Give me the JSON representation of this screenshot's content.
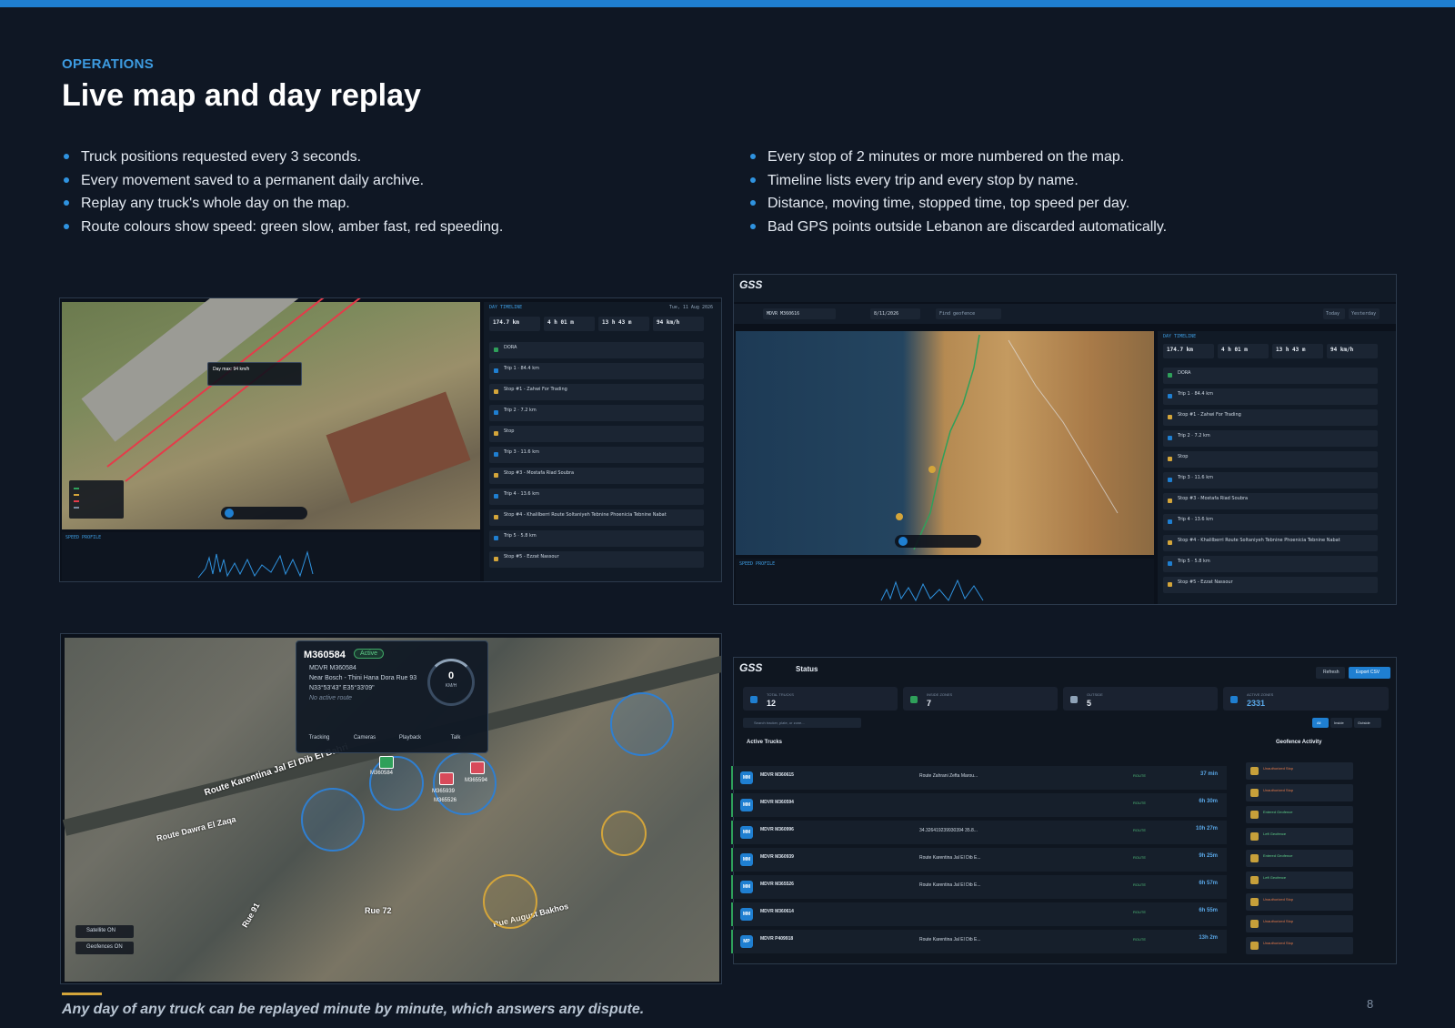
{
  "header": {
    "section_label": "OPERATIONS",
    "title": "Live map and day replay"
  },
  "bullets_left": [
    "Truck positions requested every 3 seconds.",
    "Every movement saved to a permanent daily archive.",
    "Replay any truck's whole day on the map.",
    "Route colours show speed: green slow, amber fast, red speeding."
  ],
  "bullets_right": [
    "Every stop of 2 minutes or more numbered on the map.",
    "Timeline lists every trip and every stop by name.",
    "Distance, moving time, stopped time, top speed per day.",
    "Bad GPS points outside Lebanon are discarded automatically."
  ],
  "shot1": {
    "panel_title": "DAY TIMELINE",
    "date": "Tue, 11 Aug 2026",
    "stats": [
      "174.7 km",
      "4 h 01 m",
      "13 h 43 m",
      "94 km/h"
    ],
    "tooltip_title": "Day max: 94 km/h",
    "speed_profile_label": "SPEED PROFILE",
    "timeline": [
      {
        "text": "DORA",
        "color": "#2fa05a"
      },
      {
        "text": "Trip 1 · 84.4 km",
        "color": "#1f7fd1"
      },
      {
        "text": "Stop #1 - Zahwi For Trading",
        "color": "#d4a53a"
      },
      {
        "text": "Trip 2 · 7.2 km",
        "color": "#1f7fd1"
      },
      {
        "text": "Stop",
        "color": "#d4a53a"
      },
      {
        "text": "Trip 3 · 11.6 km",
        "color": "#1f7fd1"
      },
      {
        "text": "Stop #3 - Mostafa Riad Soubra",
        "color": "#d4a53a"
      },
      {
        "text": "Trip 4 · 13.6 km",
        "color": "#1f7fd1"
      },
      {
        "text": "Stop #4 - Khalilberri Route Soltaniyeh Tebnine Phoenicia Tebnine Nabat",
        "color": "#d4a53a"
      },
      {
        "text": "Trip 5 · 5.8 km",
        "color": "#1f7fd1"
      },
      {
        "text": "Stop #5 - Ezzat Nassour",
        "color": "#d4a53a"
      }
    ]
  },
  "shot2": {
    "logo": "GSS",
    "tracker_value": "MDVR M360616",
    "date_value": "8/11/2026",
    "search_placeholder": "Find geofence",
    "today_label": "Today",
    "yesterday_label": "Yesterday",
    "panel_title": "DAY TIMELINE",
    "stats": [
      "174.7 km",
      "4 h 01 m",
      "13 h 43 m",
      "94 km/h"
    ],
    "speed_profile_label": "SPEED PROFILE"
  },
  "shot3": {
    "popup_title": "M360584",
    "popup_badge": "Active",
    "popup_lines": [
      "MDVR M360584",
      "Near Bosch - Thini Hana Dora Rue 93",
      "N33°53'43\" E35°33'09\"",
      "No active route"
    ],
    "speed_value": "0",
    "speed_unit": "KM/H",
    "actions": [
      "Tracking",
      "Cameras",
      "Playback",
      "Talk"
    ],
    "map_labels": [
      "M360584",
      "M365939",
      "M365526",
      "M365594",
      "Route Karentina Jal El Dib El Bahri",
      "Route Dawra El Zaqa",
      "Rue August Bakhos",
      "Rue 72",
      "Rue 91"
    ],
    "layer_toggles": [
      "Satellite ON",
      "Geofences ON"
    ]
  },
  "shot4": {
    "logo": "GSS",
    "title": "Status",
    "refresh_label": "Refresh",
    "export_label": "Export CSV",
    "cards": [
      {
        "label": "TOTAL TRUCKS",
        "value": "12",
        "color": "#1f7fd1"
      },
      {
        "label": "INSIDE ZONES",
        "value": "7",
        "color": "#2fa05a"
      },
      {
        "label": "OUTSIDE",
        "value": "5",
        "color": "#8fa3b8"
      },
      {
        "label": "ACTIVE ZONES",
        "value": "2331",
        "color": "#1f7fd1"
      }
    ],
    "search_placeholder": "Search tracker, plate, or zone...",
    "filters": [
      "All",
      "Inside",
      "Outside"
    ],
    "active_trucks_label": "Active Trucks",
    "geofence_label": "Geofence Activity",
    "trucks": [
      {
        "avatar": "MM",
        "name": "MDVR M360615",
        "route": "Route Zahrani Zefta Marou...",
        "status": "ROUTE",
        "time": "37 min"
      },
      {
        "avatar": "MM",
        "name": "MDVR M360594",
        "route": "",
        "status": "ROUTE",
        "time": "6h 30m"
      },
      {
        "avatar": "MM",
        "name": "MDVR M360996",
        "route": "34.326419239930394 35.8...",
        "status": "ROUTE",
        "time": "10h 27m"
      },
      {
        "avatar": "MM",
        "name": "MDVR M360939",
        "route": "Route Karentina Jal El Dib E...",
        "status": "ROUTE",
        "time": "9h 25m"
      },
      {
        "avatar": "MM",
        "name": "MDVR M365526",
        "route": "Route Karentina Jal El Dib E...",
        "status": "ROUTE",
        "time": "6h 57m"
      },
      {
        "avatar": "MM",
        "name": "MDVR M360614",
        "route": "",
        "status": "ROUTE",
        "time": "6h 55m"
      },
      {
        "avatar": "MP",
        "name": "MDVR P409918",
        "route": "Route Karentina Jal El Dib E...",
        "status": "ROUTE",
        "time": "13h 2m"
      }
    ],
    "geofence_events": [
      "Unauthorized Stop",
      "Unauthorized Stop",
      "Entered Geofence",
      "Left Geofence",
      "Entered Geofence",
      "Left Geofence",
      "Unauthorized Stop",
      "Unauthorized Stop",
      "Unauthorized Stop"
    ]
  },
  "footer": {
    "caption": "Any day of any truck can be replayed minute by minute, which answers any dispute.",
    "page_number": "8"
  }
}
